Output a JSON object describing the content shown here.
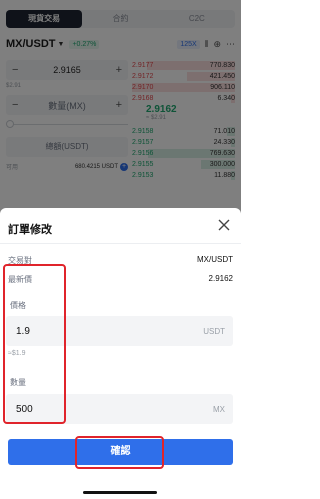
{
  "top_tabs": [
    "現貨交易",
    "合約",
    "C2C"
  ],
  "pair_bar": {
    "pair": "MX/USDT",
    "change": "+0.27%",
    "leverage": "125X"
  },
  "form": {
    "price": "2.9165",
    "price_sub": "$2.91",
    "amount_placeholder": "數量(MX)",
    "total_placeholder": "總額(USDT)",
    "available_label": "可用",
    "available_value": "680.4215 USDT"
  },
  "order_book": {
    "asks": [
      {
        "p": "2.9177",
        "q": "770.830"
      },
      {
        "p": "2.9172",
        "q": "421.450"
      },
      {
        "p": "2.9170",
        "q": "906.110"
      },
      {
        "p": "2.9168",
        "q": "6.340"
      }
    ],
    "last_price": "2.9162",
    "last_price_usd": "≈ $2.91",
    "bids": [
      {
        "p": "2.9158",
        "q": "71.010"
      },
      {
        "p": "2.9157",
        "q": "24.330"
      },
      {
        "p": "2.9156",
        "q": "769.630"
      },
      {
        "p": "2.9155",
        "q": "300.000"
      },
      {
        "p": "2.9153",
        "q": "11.880"
      }
    ]
  },
  "modal": {
    "title": "訂單修改",
    "pair_label": "交易對",
    "pair_value": "MX/USDT",
    "last_label": "最新價",
    "last_value": "2.9162",
    "price_label": "價格",
    "price_value": "1.9",
    "price_unit": "USDT",
    "price_hint": "≈$1.9",
    "qty_label": "數量",
    "qty_value": "500",
    "qty_unit": "MX",
    "confirm_label": "確認"
  },
  "colors": {
    "accent": "#2f6fea",
    "bid": "#1fa870",
    "ask": "#e5484d",
    "highlight": "#e0242b"
  }
}
